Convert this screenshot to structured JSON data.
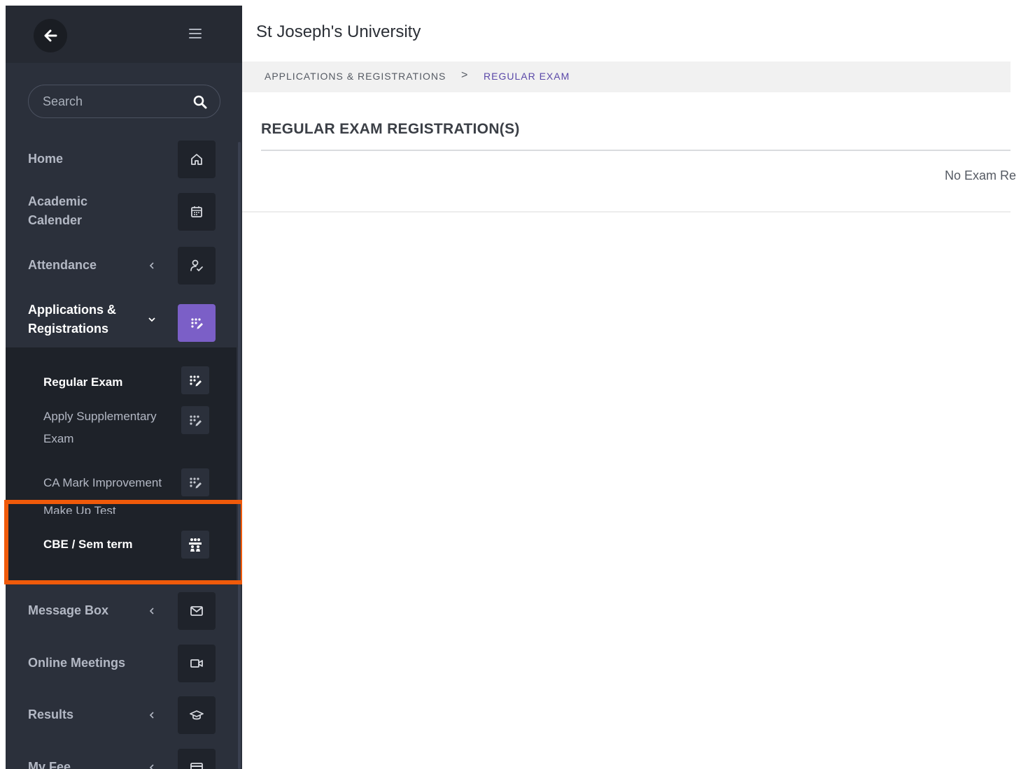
{
  "app": {
    "title": "St Joseph's University"
  },
  "sidebar": {
    "search_placeholder": "Search",
    "nav": [
      {
        "label": "Home",
        "icon": "home-icon"
      },
      {
        "label": "Academic\nCalender",
        "icon": "calendar-icon"
      },
      {
        "label": "Attendance",
        "icon": "attendance-icon"
      },
      {
        "label": "Applications &\nRegistrations",
        "icon": "registrations-icon",
        "expanded": true
      },
      {
        "label": "Message Box",
        "icon": "mail-icon"
      },
      {
        "label": "Online Meetings",
        "icon": "video-icon"
      },
      {
        "label": "Results",
        "icon": "graduation-cap-icon"
      },
      {
        "label": "My Fee",
        "icon": "card-icon"
      }
    ],
    "submenu": [
      {
        "label": "Regular Exam",
        "current": true
      },
      {
        "label": "Apply Supplementary\nExam"
      },
      {
        "label": "CA Mark Improvement"
      },
      {
        "label": "Make Up Test"
      },
      {
        "label": "CBE / Sem term"
      }
    ]
  },
  "breadcrumb": {
    "parent": "APPLICATIONS & REGISTRATIONS",
    "separator": ">",
    "current": "REGULAR EXAM"
  },
  "main": {
    "section_title": "REGULAR EXAM REGISTRATION(S)",
    "empty_message": "No Exam Re"
  },
  "colors": {
    "sidebar_bg": "#2b303b",
    "submenu_bg": "#1e2229",
    "accent": "#7b5fc7",
    "highlight": "#f05a0a",
    "breadcrumb_current": "#5a48a8"
  }
}
